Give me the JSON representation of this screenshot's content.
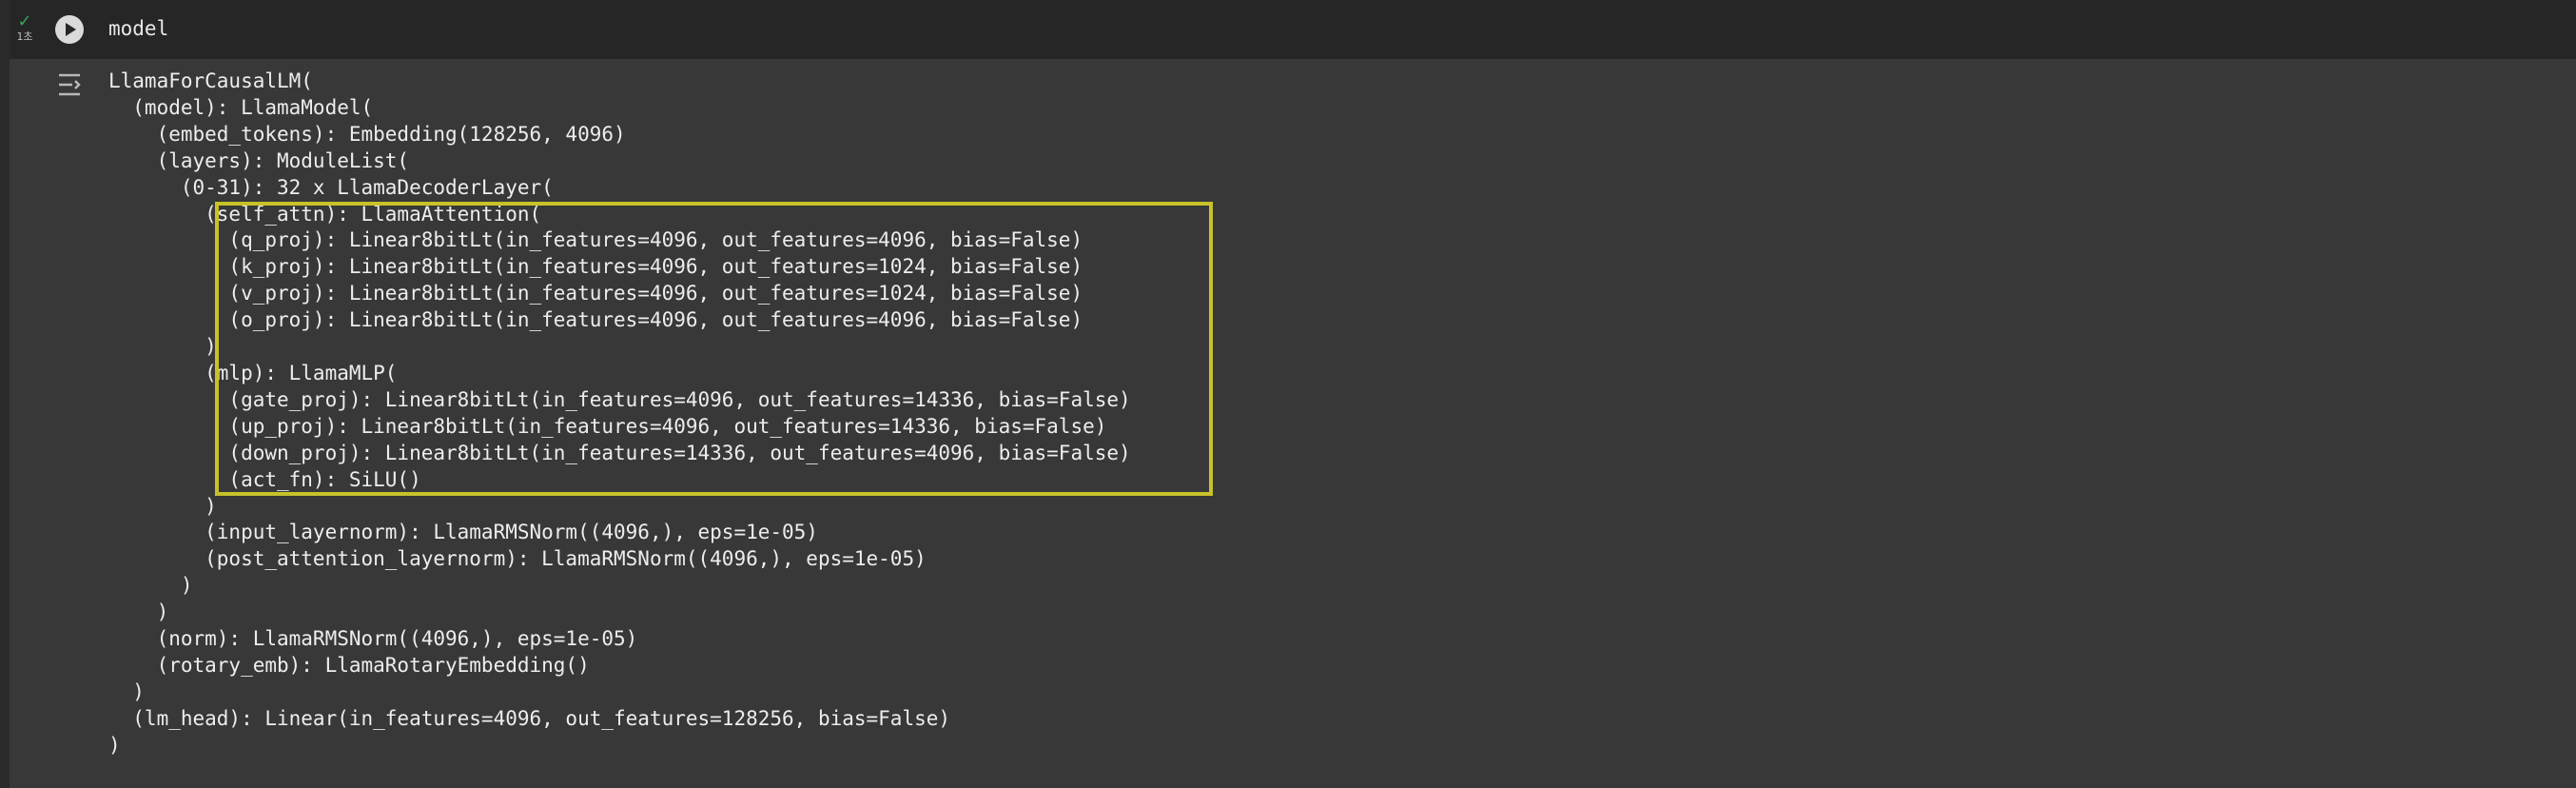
{
  "cell": {
    "status_check": "✓",
    "status_time": "1초",
    "code": "model"
  },
  "highlight_color": "#c8c228",
  "output_lines": [
    "LlamaForCausalLM(",
    "  (model): LlamaModel(",
    "    (embed_tokens): Embedding(128256, 4096)",
    "    (layers): ModuleList(",
    "      (0-31): 32 x LlamaDecoderLayer(",
    "        (self_attn): LlamaAttention(",
    "          (q_proj): Linear8bitLt(in_features=4096, out_features=4096, bias=False)",
    "          (k_proj): Linear8bitLt(in_features=4096, out_features=1024, bias=False)",
    "          (v_proj): Linear8bitLt(in_features=4096, out_features=1024, bias=False)",
    "          (o_proj): Linear8bitLt(in_features=4096, out_features=4096, bias=False)",
    "        )",
    "        (mlp): LlamaMLP(",
    "          (gate_proj): Linear8bitLt(in_features=4096, out_features=14336, bias=False)",
    "          (up_proj): Linear8bitLt(in_features=4096, out_features=14336, bias=False)",
    "          (down_proj): Linear8bitLt(in_features=14336, out_features=4096, bias=False)",
    "          (act_fn): SiLU()",
    "        )",
    "        (input_layernorm): LlamaRMSNorm((4096,), eps=1e-05)",
    "        (post_attention_layernorm): LlamaRMSNorm((4096,), eps=1e-05)",
    "      )",
    "    )",
    "    (norm): LlamaRMSNorm((4096,), eps=1e-05)",
    "    (rotary_emb): LlamaRotaryEmbedding()",
    "  )",
    "  (lm_head): Linear(in_features=4096, out_features=128256, bias=False)",
    ")"
  ]
}
